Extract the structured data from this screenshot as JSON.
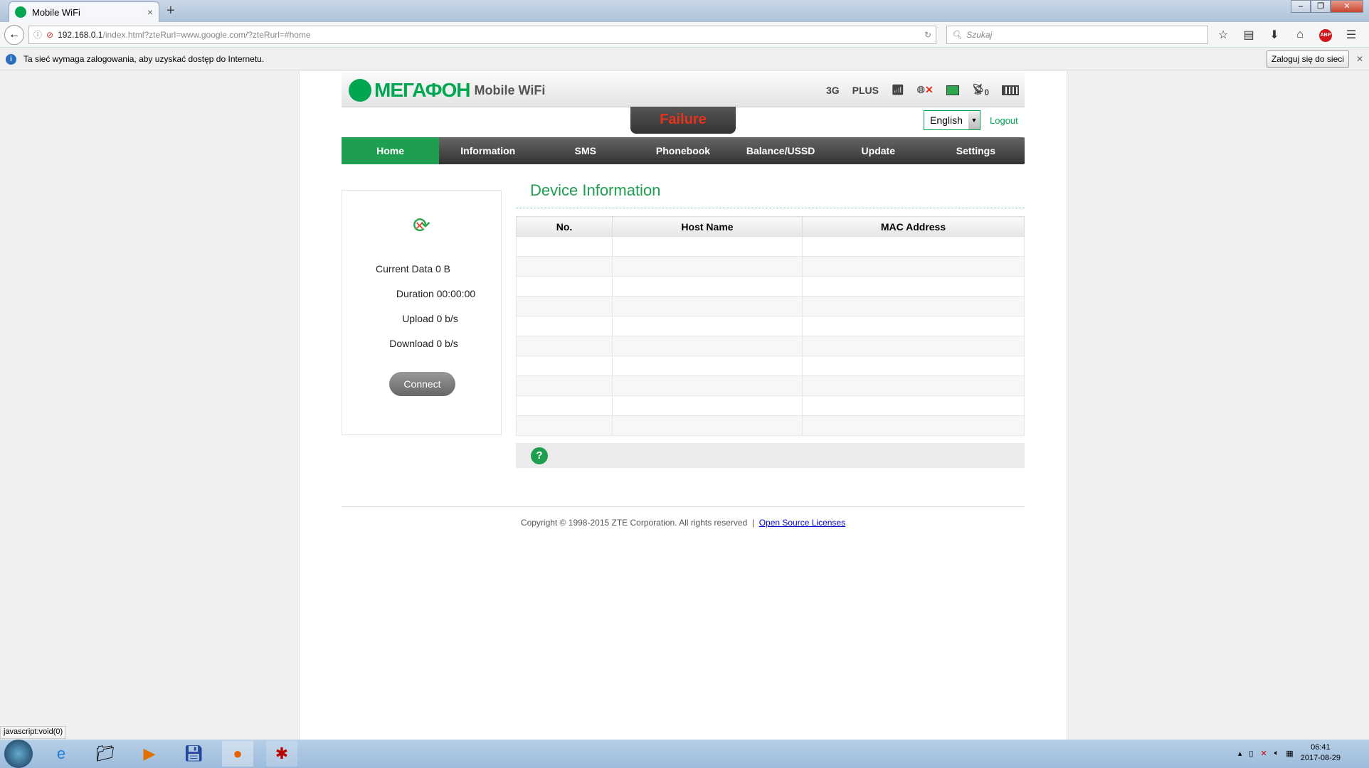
{
  "browser": {
    "tab_title": "Mobile WiFi",
    "url_host": "192.168.0.1",
    "url_path": "/index.html?zteRurl=www.google.com/?zteRurl=#home",
    "search_placeholder": "Szukaj",
    "info_message": "Ta sieć wymaga zalogowania, aby uzyskać dostęp do Internetu.",
    "login_button": "Zaloguj się do sieci",
    "status_text": "javascript:void(0)"
  },
  "header": {
    "brand": "МЕГАФОН",
    "product": "Mobile WiFi",
    "network_type": "3G",
    "operator": "PLUS",
    "wifi_clients": "0",
    "connection_status": "Failure",
    "language": "English",
    "logout": "Logout"
  },
  "menu": [
    {
      "label": "Home"
    },
    {
      "label": "Information"
    },
    {
      "label": "SMS"
    },
    {
      "label": "Phonebook"
    },
    {
      "label": "Balance/USSD"
    },
    {
      "label": "Update"
    },
    {
      "label": "Settings"
    }
  ],
  "left": {
    "current_data": "Current Data 0 B",
    "duration": "Duration 00:00:00",
    "upload": "Upload 0 b/s",
    "download": "Download 0 b/s",
    "connect": "Connect"
  },
  "device_info": {
    "title": "Device Information",
    "columns": [
      "No.",
      "Host Name",
      "MAC Address"
    ],
    "row_count": 10
  },
  "footer": {
    "copyright": "Copyright © 1998-2015 ZTE Corporation. All rights reserved  |  ",
    "link": "Open Source Licenses"
  },
  "taskbar": {
    "time": "06:41",
    "date": "2017-08-29"
  },
  "colors": {
    "brand": "#00a650",
    "active_menu": "#1d9f4f",
    "failure": "#e8321c"
  }
}
